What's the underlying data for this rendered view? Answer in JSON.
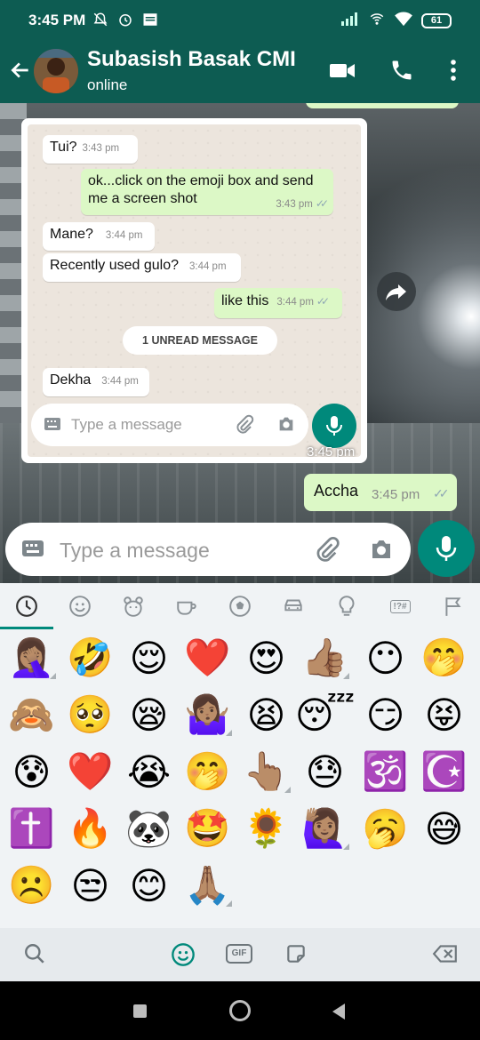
{
  "status_bar": {
    "time": "3:45 PM",
    "battery": "61"
  },
  "header": {
    "contact_name": "Subasish Basak CMI",
    "contact_status": "online"
  },
  "screenshot_card": {
    "messages": [
      {
        "direction": "in",
        "text": "Tui?",
        "time": "3:43 pm"
      },
      {
        "direction": "out",
        "text": "ok...click on the emoji box and send me a screen shot",
        "time": "3:43 pm"
      },
      {
        "direction": "in",
        "text": "Mane?",
        "time": "3:44 pm"
      },
      {
        "direction": "in",
        "text": "Recently used gulo?",
        "time": "3:44 pm"
      },
      {
        "direction": "out",
        "text": "like this",
        "time": "3:44 pm"
      },
      {
        "direction": "in",
        "text": "Dekha",
        "time": "3:44 pm"
      }
    ],
    "unread_label": "1 UNREAD MESSAGE",
    "input_placeholder": "Type a message",
    "image_time": "3:45 pm"
  },
  "sent_message": {
    "text": "Accha",
    "time": "3:45 pm"
  },
  "input": {
    "placeholder": "Type a message"
  },
  "emoji_keyboard": {
    "categories": [
      "recent-icon",
      "smileys-icon",
      "animals-icon",
      "food-icon",
      "activity-icon",
      "travel-icon",
      "objects-icon",
      "symbols-icon",
      "flags-icon"
    ],
    "symbols_label": "!?#",
    "selected_category": "recent",
    "emojis": [
      "🤦🏽‍♀️",
      "🤣",
      "😌",
      "❤️",
      "😍",
      "👍🏽",
      "😶",
      "🤭",
      "🙈",
      "🥺",
      "😪",
      "🤷🏽‍♀️",
      "😫",
      "😴",
      "😏",
      "😝",
      "😰",
      "❤️",
      "😭",
      "🤭",
      "👆🏽",
      "😓",
      "🕉️",
      "☪️",
      "✝️",
      "🔥",
      "🐼",
      "🤩",
      "🌻",
      "🙋🏽‍♀️",
      "🥱",
      "😅",
      "☹️",
      "😒",
      "😊",
      "🙏🏽"
    ],
    "gif_label": "GIF"
  }
}
